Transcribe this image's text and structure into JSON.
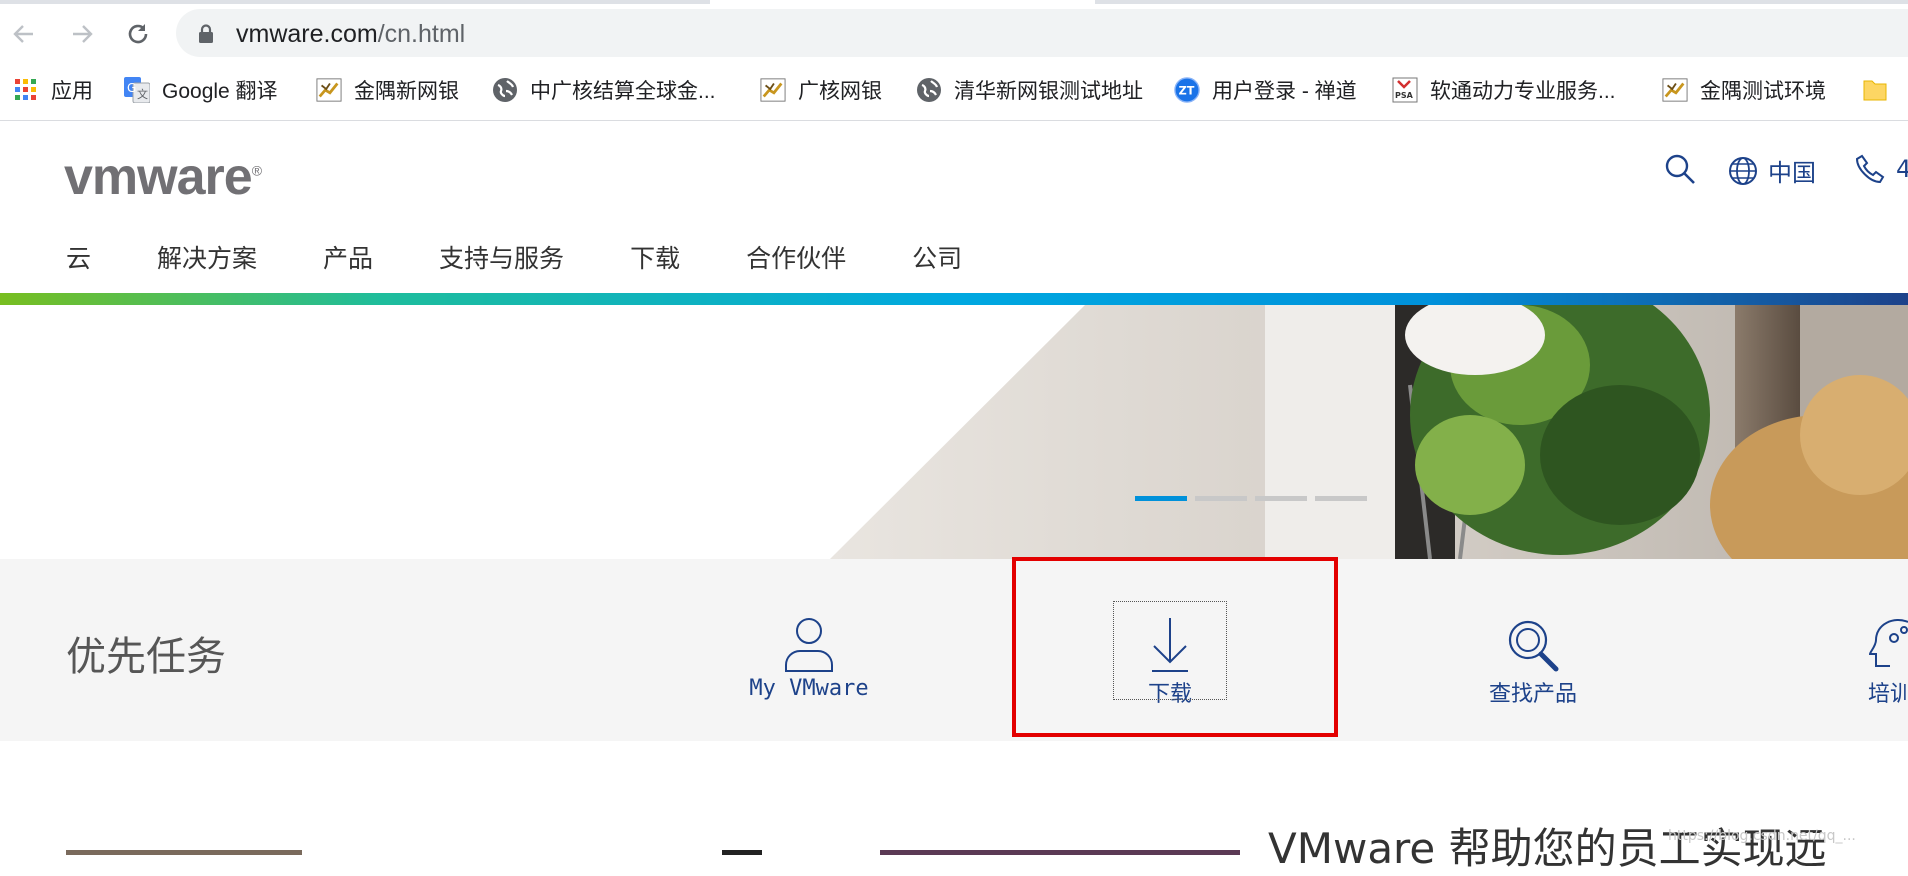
{
  "browser": {
    "url_host": "vmware.com",
    "url_path": "/cn.html",
    "bookmarks": [
      {
        "label": "应用",
        "icon": "apps-grid-icon"
      },
      {
        "label": "Google 翻译",
        "icon": "google-translate-icon"
      },
      {
        "label": "金隅新网银",
        "icon": "tiger-icon"
      },
      {
        "label": "中广核结算全球金...",
        "icon": "globe-icon"
      },
      {
        "label": "广核网银",
        "icon": "tiger-icon"
      },
      {
        "label": "清华新网银测试地址",
        "icon": "globe-icon"
      },
      {
        "label": "用户登录 - 禅道",
        "icon": "zentao-icon"
      },
      {
        "label": "软通动力专业服务...",
        "icon": "psa-icon"
      },
      {
        "label": "金隅测试环境",
        "icon": "tiger-icon"
      },
      {
        "label": "",
        "icon": "folder-icon"
      }
    ]
  },
  "site": {
    "logo": "vmware",
    "region": "中国",
    "phone_partial": "4",
    "nav": [
      "云",
      "解决方案",
      "产品",
      "支持与服务",
      "下载",
      "合作伙伴",
      "公司"
    ]
  },
  "hero": {
    "slides": 4,
    "active_slide": 1
  },
  "tasks": {
    "title": "优先任务",
    "items": [
      {
        "label": "My VMware",
        "icon": "user-icon"
      },
      {
        "label": "下载",
        "icon": "download-icon"
      },
      {
        "label": "查找产品",
        "icon": "search-product-icon"
      },
      {
        "label": "培训",
        "icon": "training-icon"
      }
    ]
  },
  "bottom": {
    "heading": "VMware 帮助您的员工实现远"
  },
  "watermark": "https://blog.csdn.net/qq_..."
}
